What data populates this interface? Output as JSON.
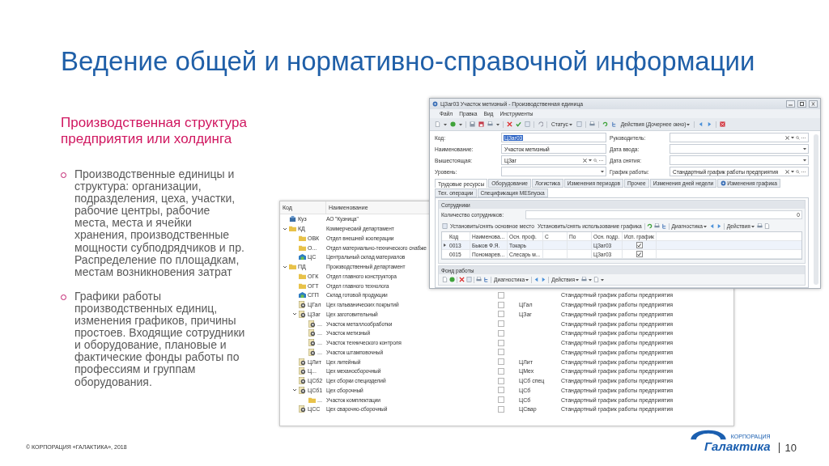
{
  "slide": {
    "title": "Ведение общей и нормативно-справочной информации",
    "subtitle": "Производственная структура предприятия или холдинга",
    "bullets": [
      "Производственные единицы и структура: организации, подразделения, цеха, участки, рабочие центры, рабочие места, места и ячейки хранения, производственные мощности субподрядчиков и пр. Распределение по площадкам, местам возникновения затрат",
      "Графики работы производственных единиц, изменения графиков, причины простоев. Входящие сотрудники и оборудование, плановые и фактические фонды работы по профессиям и группам оборудования."
    ],
    "footer": "© КОРПОРАЦИЯ «ГАЛАКТИКА», 2018",
    "logo": {
      "name": "Галактика",
      "caption": "КОРПОРАЦИЯ"
    },
    "page": "10"
  },
  "tree_window": {
    "columns": [
      "Код",
      "Наименование"
    ],
    "nodes": [
      {
        "code": "Куз",
        "name": "АО \"Кузница\"",
        "kind": "company"
      },
      {
        "code": "КД",
        "name": "Коммерческий департамент",
        "kind": "folder",
        "expanded": true,
        "children": [
          {
            "code": "ОВК",
            "name": "Отдел внешней кооперации",
            "kind": "folder"
          },
          {
            "code": "О...",
            "name": "Отдел материально-технического снабже",
            "kind": "folder"
          },
          {
            "code": "ЦС",
            "name": "Центральный склад материалов",
            "kind": "warehouse"
          }
        ]
      },
      {
        "code": "ПД",
        "name": "Производственный департамент",
        "kind": "folder",
        "expanded": true,
        "children": [
          {
            "code": "ОГК",
            "name": "Отдел главного конструктора",
            "kind": "folder"
          },
          {
            "code": "ОГТ",
            "name": "Отдел главного технолога",
            "kind": "folder"
          },
          {
            "code": "СГП",
            "name": "Склад готовой продукции",
            "kind": "warehouse",
            "checked": false,
            "schedule": "Стандартный график работы предприятия"
          },
          {
            "code": "ЦГал",
            "name": "Цех гальванических покрытий",
            "kind": "workshop",
            "checked": false,
            "unit": "ЦГал",
            "schedule": "Стандартный график работы предприятия"
          },
          {
            "code": "ЦЗаг",
            "name": "Цех заготовительный",
            "kind": "workshop",
            "expanded": true,
            "checked": false,
            "unit": "ЦЗаг",
            "schedule": "Стандартный график работы предприятия",
            "children": [
              {
                "code": "...",
                "name": "Участок металлообработки",
                "kind": "workshop",
                "checked": false,
                "schedule": "Стандартный график работы предприятия"
              },
              {
                "code": "...",
                "name": "Участок метизный",
                "kind": "workshop",
                "checked": false,
                "schedule": "Стандартный график работы предприятия"
              },
              {
                "code": "...",
                "name": "Участок технического контроля",
                "kind": "workshop",
                "checked": false,
                "schedule": "Стандартный график работы предприятия"
              },
              {
                "code": "...",
                "name": "Участок штамповочный",
                "kind": "workshop",
                "checked": false,
                "schedule": "Стандартный график работы предприятия"
              }
            ]
          },
          {
            "code": "ЦЛит",
            "name": "Цех литейный",
            "kind": "workshop",
            "checked": false,
            "unit": "ЦЛит",
            "schedule": "Стандартный график работы предприятия"
          },
          {
            "code": "Ц...",
            "name": "Цех механосборочный",
            "kind": "workshop",
            "checked": false,
            "unit": "ЦМех",
            "schedule": "Стандартный график работы предприятия"
          },
          {
            "code": "ЦСб2",
            "name": "Цех сборки специзделий",
            "kind": "workshop",
            "checked": false,
            "unit": "ЦСб спец",
            "schedule": "Стандартный график работы предприятия"
          },
          {
            "code": "ЦСб1",
            "name": "Цех сборочный",
            "kind": "workshop",
            "expanded": true,
            "checked": false,
            "unit": "ЦСб",
            "schedule": "Стандартный график работы предприятия",
            "children": [
              {
                "code": "...",
                "name": "Участок комплектации",
                "kind": "folder",
                "checked": false,
                "unit": "ЦСб",
                "schedule": "Стандартный график работы предприятия"
              }
            ]
          },
          {
            "code": "ЦСС",
            "name": "Цех сварочно-сборочный",
            "kind": "workshop",
            "checked": false,
            "unit": "ЦСвар",
            "schedule": "Стандартный график работы предприятия"
          }
        ]
      }
    ]
  },
  "form_window": {
    "title": "ЦЗаг03 Участок метизный - Производственная единица",
    "menu": [
      "Файл",
      "Правка",
      "Вид",
      "Инструменты"
    ],
    "toolbar": {
      "status": "Статус",
      "actions": "Действия (Дочернее окно)"
    },
    "fields_left": [
      {
        "label": "Код:",
        "value": "ЦЗаг03",
        "selected": true,
        "kind": "text"
      },
      {
        "label": "Наименование:",
        "value": "Участок метизный",
        "selected": false,
        "kind": "text"
      },
      {
        "label": "Вышестоящая:",
        "value": "ЦЗаг",
        "selected": false,
        "kind": "lookup"
      },
      {
        "label": "Уровень:",
        "kind": "dropdown"
      }
    ],
    "fields_right": [
      {
        "label": "Руководитель:",
        "kind": "lookup"
      },
      {
        "label": "Дата ввода:",
        "kind": "dropdown"
      },
      {
        "label": "Дата снятия:",
        "kind": "dropdown"
      },
      {
        "label": "График работы:",
        "value": "Стандартный график работы предприятия",
        "selected": false,
        "kind": "lookup"
      }
    ],
    "tabs": [
      {
        "label": "Трудовые ресурсы",
        "selected": true
      },
      {
        "label": "Оборудование",
        "selected": false
      },
      {
        "label": "Логистика",
        "selected": false
      },
      {
        "label": "Изменения периодов",
        "selected": false
      },
      {
        "label": "Прочее",
        "selected": false
      },
      {
        "label": "Изменения дней недели",
        "selected": false
      },
      {
        "label": "Изменения графика",
        "selected": false,
        "icon": true
      },
      {
        "label": "Тех. операции",
        "selected": false
      },
      {
        "label": "Спецификация MESпуска",
        "selected": false
      }
    ],
    "staff": {
      "title": "Сотрудники",
      "count_label": "Количество сотрудников:",
      "count": "0",
      "toolbar": {
        "set_main": "Установить/снять основное место",
        "set_schedule": "Установить/снять использование графика",
        "diagnostics": "Диагностика",
        "actions": "Действия"
      },
      "columns": [
        "Код",
        "Наименова...",
        "Осн. проф.",
        "С",
        "По",
        "Осн. подр.",
        "Исп. график"
      ],
      "rows": [
        {
          "current": true,
          "code": "0013",
          "name": "Быков Ф.Я.",
          "profession": "Токарь",
          "unit": "ЦЗаг03",
          "checked": true
        },
        {
          "current": false,
          "code": "0015",
          "name": "Пономарев...",
          "profession": "Слесарь м...",
          "unit": "ЦЗаг03",
          "checked": true
        }
      ]
    },
    "work_fund": {
      "title": "Фонд работы",
      "toolbar": {
        "diagnostics": "Диагностика",
        "actions": "Действия"
      }
    }
  }
}
